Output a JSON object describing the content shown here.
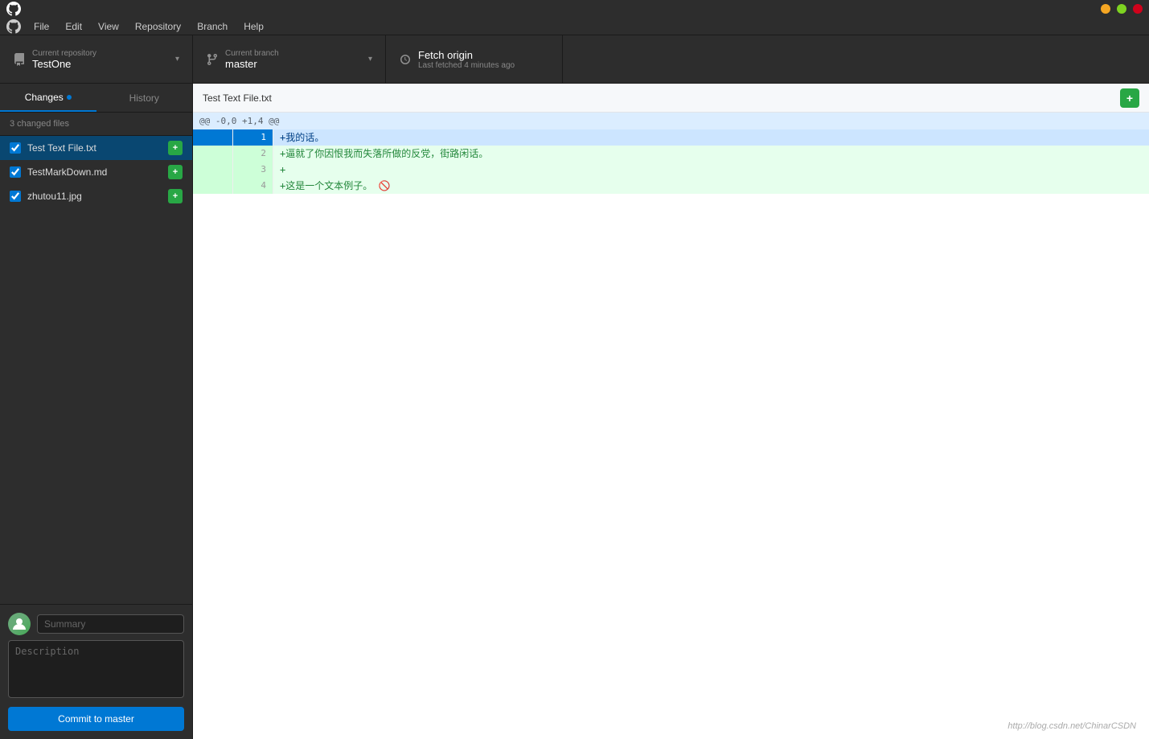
{
  "titlebar": {
    "btn_minimize": "−",
    "btn_maximize": "□",
    "btn_close": "×"
  },
  "menubar": {
    "items": [
      "File",
      "Edit",
      "View",
      "Repository",
      "Branch",
      "Help"
    ]
  },
  "toolbar": {
    "current_repo_label": "Current repository",
    "current_repo_name": "TestOne",
    "current_branch_label": "Current branch",
    "current_branch_name": "master",
    "fetch_label": "Fetch origin",
    "fetch_sublabel": "Last fetched 4 minutes ago"
  },
  "sidebar": {
    "tab_changes": "Changes",
    "tab_history": "History",
    "changed_files_label": "3 changed files",
    "files": [
      {
        "name": "Test Text File.txt",
        "checked": true,
        "active": true
      },
      {
        "name": "TestMarkDown.md",
        "checked": true,
        "active": false
      },
      {
        "name": "zhutou11.jpg",
        "checked": true,
        "active": false
      }
    ]
  },
  "commit": {
    "summary_placeholder": "Summary",
    "description_placeholder": "Description",
    "commit_button_label": "Commit to master"
  },
  "diff": {
    "filename": "Test Text File.txt",
    "hunk_header": "@@ -0,0 +1,4 @@",
    "lines": [
      {
        "old_num": "",
        "new_num": "1",
        "type": "added",
        "content": "+我的话。",
        "selected": true
      },
      {
        "old_num": "",
        "new_num": "2",
        "type": "added",
        "content": "+逼就了你因恨我而失落所做的反党，街路闲话。",
        "selected": false
      },
      {
        "old_num": "",
        "new_num": "3",
        "type": "added",
        "content": "+",
        "selected": false
      },
      {
        "old_num": "",
        "new_num": "4",
        "type": "added",
        "content": "+这是一个文本例子。 🚫",
        "selected": false
      }
    ]
  },
  "watermark": "http://blog.csdn.net/ChinarCSDN"
}
